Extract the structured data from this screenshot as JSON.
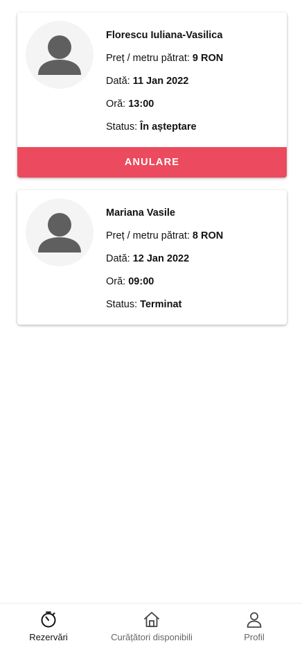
{
  "reservations": [
    {
      "name": "Florescu Iuliana-Vasilica",
      "price_label": "Preț / metru pătrat:",
      "price_value": "9 RON",
      "date_label": "Dată:",
      "date_value": "11 Jan 2022",
      "time_label": "Oră:",
      "time_value": "13:00",
      "status_label": "Status:",
      "status_value": "În așteptare",
      "cancel_label": "ANULARE"
    },
    {
      "name": "Mariana Vasile",
      "price_label": "Preț / metru pătrat:",
      "price_value": "8 RON",
      "date_label": "Dată:",
      "date_value": "12 Jan 2022",
      "time_label": "Oră:",
      "time_value": "09:00",
      "status_label": "Status:",
      "status_value": "Terminat"
    }
  ],
  "bottom_nav": {
    "items": [
      {
        "label": "Rezervări",
        "icon": "timer-icon",
        "active": true
      },
      {
        "label": "Curățători disponibili",
        "icon": "home-icon",
        "active": false
      },
      {
        "label": "Profil",
        "icon": "person-icon",
        "active": false
      }
    ]
  },
  "colors": {
    "accent": "#ec4a5e",
    "avatar_bg": "#f4f4f4",
    "avatar_fg": "#5f5f5f",
    "nav_active": "#111111",
    "nav_inactive": "#666666"
  }
}
